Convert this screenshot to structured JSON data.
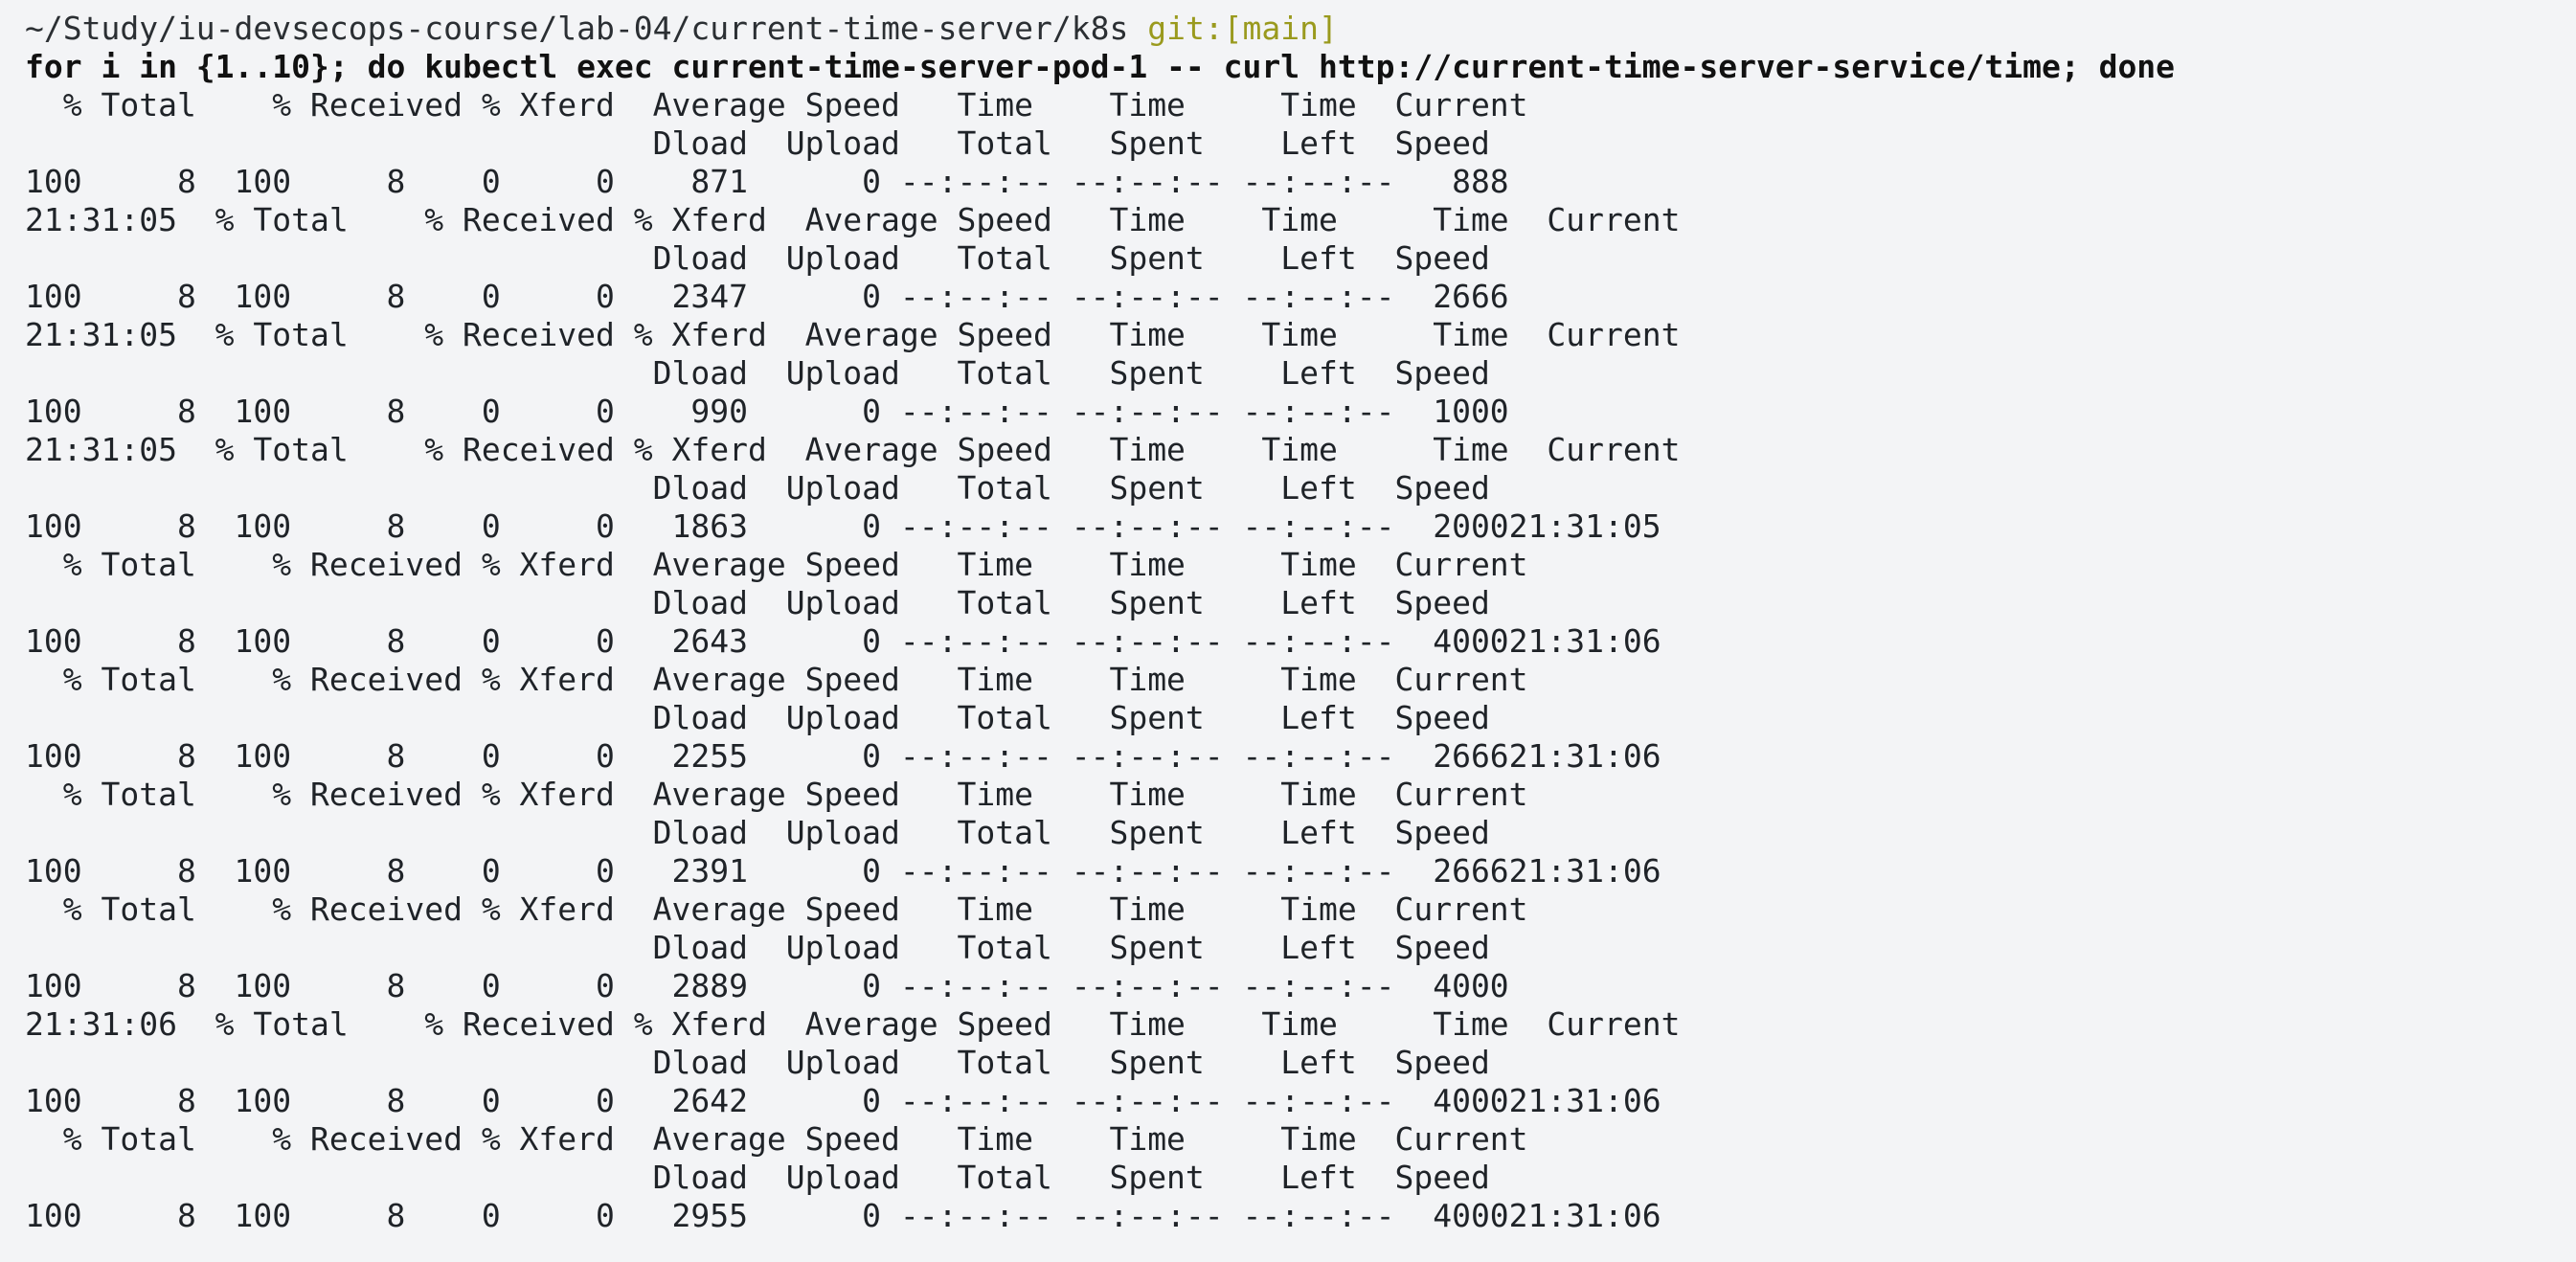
{
  "prompt": {
    "path": "~/Study/iu-devsecops-course/lab-04/current-time-server/k8s",
    "git": "git:[main]"
  },
  "command": "for i in {1..10}; do kubectl exec current-time-server-pod-1 -- curl http://current-time-server-service/time; done",
  "output_lines": [
    "  % Total    % Received % Xferd  Average Speed   Time    Time     Time  Current",
    "                                 Dload  Upload   Total   Spent    Left  Speed",
    "100     8  100     8    0     0    871      0 --:--:-- --:--:-- --:--:--   888",
    "21:31:05  % Total    % Received % Xferd  Average Speed   Time    Time     Time  Current",
    "                                 Dload  Upload   Total   Spent    Left  Speed",
    "100     8  100     8    0     0   2347      0 --:--:-- --:--:-- --:--:--  2666",
    "21:31:05  % Total    % Received % Xferd  Average Speed   Time    Time     Time  Current",
    "                                 Dload  Upload   Total   Spent    Left  Speed",
    "100     8  100     8    0     0    990      0 --:--:-- --:--:-- --:--:--  1000",
    "21:31:05  % Total    % Received % Xferd  Average Speed   Time    Time     Time  Current",
    "                                 Dload  Upload   Total   Spent    Left  Speed",
    "100     8  100     8    0     0   1863      0 --:--:-- --:--:-- --:--:--  200021:31:05",
    "  % Total    % Received % Xferd  Average Speed   Time    Time     Time  Current",
    "                                 Dload  Upload   Total   Spent    Left  Speed",
    "100     8  100     8    0     0   2643      0 --:--:-- --:--:-- --:--:--  400021:31:06",
    "  % Total    % Received % Xferd  Average Speed   Time    Time     Time  Current",
    "                                 Dload  Upload   Total   Spent    Left  Speed",
    "100     8  100     8    0     0   2255      0 --:--:-- --:--:-- --:--:--  266621:31:06",
    "  % Total    % Received % Xferd  Average Speed   Time    Time     Time  Current",
    "                                 Dload  Upload   Total   Spent    Left  Speed",
    "100     8  100     8    0     0   2391      0 --:--:-- --:--:-- --:--:--  266621:31:06",
    "  % Total    % Received % Xferd  Average Speed   Time    Time     Time  Current",
    "                                 Dload  Upload   Total   Spent    Left  Speed",
    "100     8  100     8    0     0   2889      0 --:--:-- --:--:-- --:--:--  4000",
    "21:31:06  % Total    % Received % Xferd  Average Speed   Time    Time     Time  Current",
    "                                 Dload  Upload   Total   Spent    Left  Speed",
    "100     8  100     8    0     0   2642      0 --:--:-- --:--:-- --:--:--  400021:31:06",
    "  % Total    % Received % Xferd  Average Speed   Time    Time     Time  Current",
    "                                 Dload  Upload   Total   Spent    Left  Speed",
    "100     8  100     8    0     0   2955      0 --:--:-- --:--:-- --:--:--  400021:31:06"
  ],
  "colors": {
    "background": "#f3f4f6",
    "text": "#1f2328",
    "git_label": "#9a9a1e"
  }
}
